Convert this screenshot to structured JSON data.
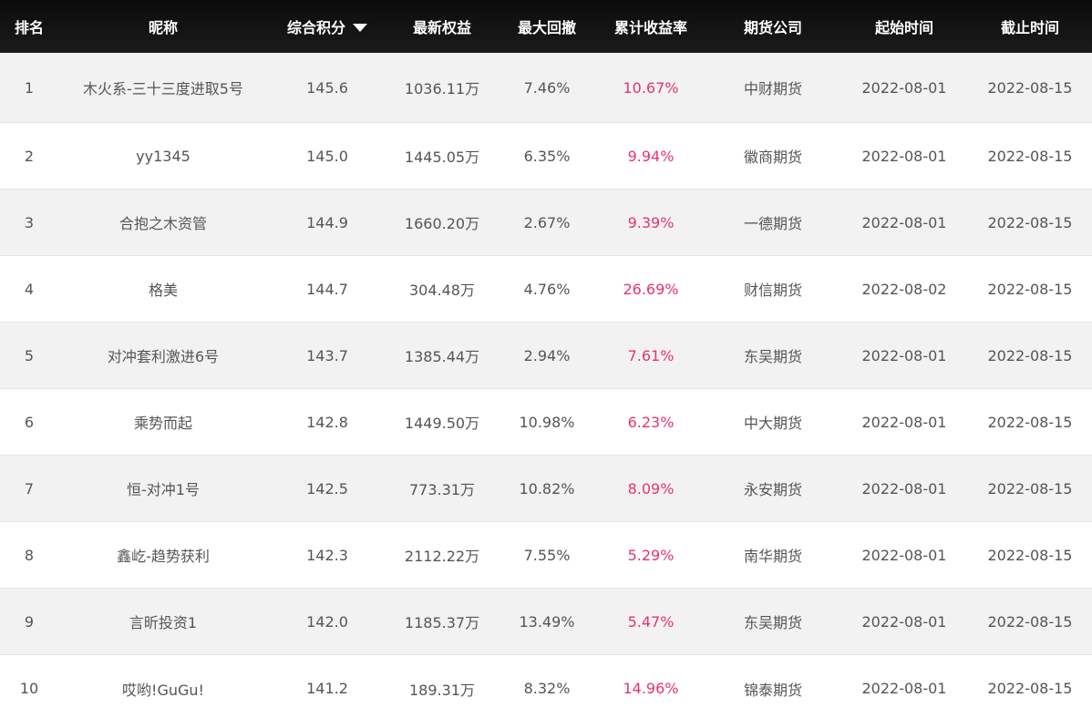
{
  "header": {
    "rank": "排名",
    "name": "昵称",
    "score": "综合积分",
    "equity": "最新权益",
    "max_drawdown": "最大回撤",
    "cum_return": "累计收益率",
    "broker": "期货公司",
    "start": "起始时间",
    "end": "截止时间"
  },
  "sort_icon": "caret-down-icon",
  "accent_color": "#e8336d",
  "rows": [
    {
      "rank": "1",
      "name": "木火系-三十三度进取5号",
      "score": "145.6",
      "equity": "1036.11万",
      "max_drawdown": "7.46%",
      "cum_return": "10.67%",
      "broker": "中财期货",
      "start": "2022-08-01",
      "end": "2022-08-15"
    },
    {
      "rank": "2",
      "name": "yy1345",
      "score": "145.0",
      "equity": "1445.05万",
      "max_drawdown": "6.35%",
      "cum_return": "9.94%",
      "broker": "徽商期货",
      "start": "2022-08-01",
      "end": "2022-08-15"
    },
    {
      "rank": "3",
      "name": "合抱之木资管",
      "score": "144.9",
      "equity": "1660.20万",
      "max_drawdown": "2.67%",
      "cum_return": "9.39%",
      "broker": "一德期货",
      "start": "2022-08-01",
      "end": "2022-08-15"
    },
    {
      "rank": "4",
      "name": "格美",
      "score": "144.7",
      "equity": "304.48万",
      "max_drawdown": "4.76%",
      "cum_return": "26.69%",
      "broker": "财信期货",
      "start": "2022-08-02",
      "end": "2022-08-15"
    },
    {
      "rank": "5",
      "name": "对冲套利激进6号",
      "score": "143.7",
      "equity": "1385.44万",
      "max_drawdown": "2.94%",
      "cum_return": "7.61%",
      "broker": "东吴期货",
      "start": "2022-08-01",
      "end": "2022-08-15"
    },
    {
      "rank": "6",
      "name": "乘势而起",
      "score": "142.8",
      "equity": "1449.50万",
      "max_drawdown": "10.98%",
      "cum_return": "6.23%",
      "broker": "中大期货",
      "start": "2022-08-01",
      "end": "2022-08-15"
    },
    {
      "rank": "7",
      "name": "恒-对冲1号",
      "score": "142.5",
      "equity": "773.31万",
      "max_drawdown": "10.82%",
      "cum_return": "8.09%",
      "broker": "永安期货",
      "start": "2022-08-01",
      "end": "2022-08-15"
    },
    {
      "rank": "8",
      "name": "鑫屹-趋势获利",
      "score": "142.3",
      "equity": "2112.22万",
      "max_drawdown": "7.55%",
      "cum_return": "5.29%",
      "broker": "南华期货",
      "start": "2022-08-01",
      "end": "2022-08-15"
    },
    {
      "rank": "9",
      "name": "言昕投资1",
      "score": "142.0",
      "equity": "1185.37万",
      "max_drawdown": "13.49%",
      "cum_return": "5.47%",
      "broker": "东吴期货",
      "start": "2022-08-01",
      "end": "2022-08-15"
    },
    {
      "rank": "10",
      "name": "哎哟!GuGu!",
      "score": "141.2",
      "equity": "189.31万",
      "max_drawdown": "8.32%",
      "cum_return": "14.96%",
      "broker": "锦泰期货",
      "start": "2022-08-01",
      "end": "2022-08-15"
    }
  ]
}
